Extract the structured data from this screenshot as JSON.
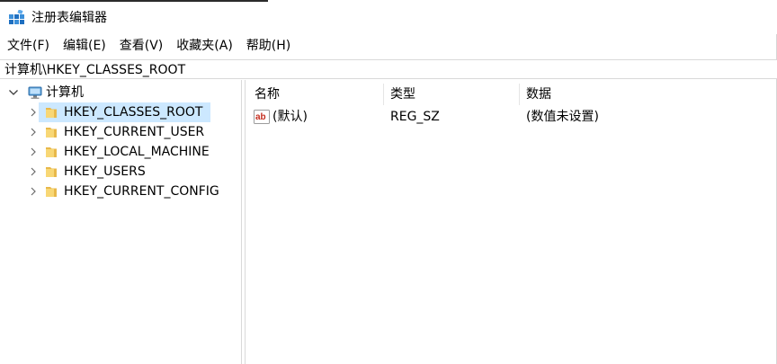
{
  "window": {
    "title": "注册表编辑器"
  },
  "menu": [
    {
      "label": "文件(F)"
    },
    {
      "label": "编辑(E)"
    },
    {
      "label": "查看(V)"
    },
    {
      "label": "收藏夹(A)"
    },
    {
      "label": "帮助(H)"
    }
  ],
  "address": {
    "path": "计算机\\HKEY_CLASSES_ROOT"
  },
  "tree": {
    "root": {
      "label": "计算机",
      "icon": "computer-icon",
      "expanded": true
    },
    "children": [
      {
        "label": "HKEY_CLASSES_ROOT",
        "icon": "folder-icon",
        "selected": true
      },
      {
        "label": "HKEY_CURRENT_USER",
        "icon": "folder-icon"
      },
      {
        "label": "HKEY_LOCAL_MACHINE",
        "icon": "folder-icon"
      },
      {
        "label": "HKEY_USERS",
        "icon": "folder-icon"
      },
      {
        "label": "HKEY_CURRENT_CONFIG",
        "icon": "folder-icon"
      }
    ]
  },
  "list": {
    "columns": [
      {
        "label": "名称"
      },
      {
        "label": "类型"
      },
      {
        "label": "数据"
      }
    ],
    "rows": [
      {
        "name": "(默认)",
        "type": "REG_SZ",
        "data": "(数值未设置)",
        "icon": "string-value-icon"
      }
    ]
  },
  "colors": {
    "selection": "#cce8ff",
    "folder": "#f8d775",
    "folder_dark": "#e8b84a",
    "accent": "#0078d7"
  }
}
